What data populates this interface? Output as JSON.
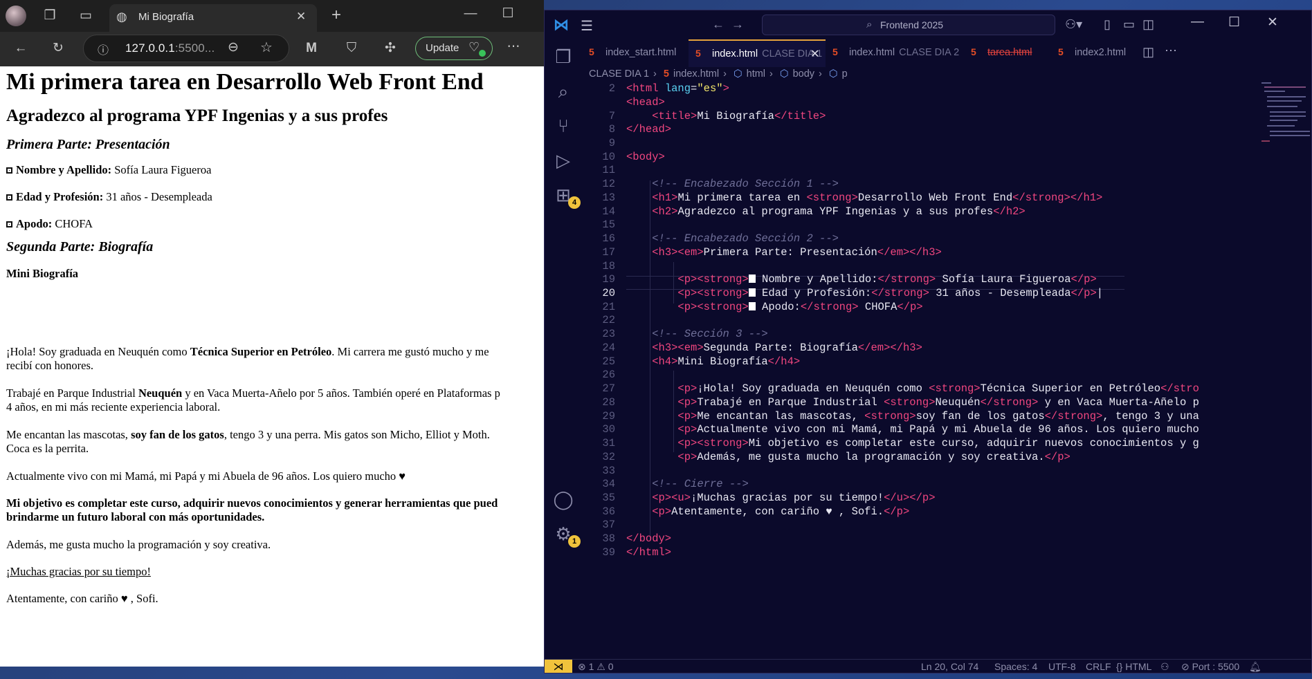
{
  "browser": {
    "tab_title": "Mi Biografía",
    "url": "127.0.0.1",
    "url_rest": ":5500...",
    "update_label": "Update"
  },
  "page": {
    "h1": "Mi primera tarea en Desarrollo Web Front End",
    "h2": "Agradezco al programa YPF Ingenias y a sus profes",
    "h3_1": "Primera Parte: Presentación",
    "item1_label": "Nombre y Apellido:",
    "item1_value": " Sofía Laura Figueroa",
    "item2_label": "Edad y Profesión:",
    "item2_value": " 31 años - Desempleada",
    "item3_label": "Apodo:",
    "item3_value": " CHOFA",
    "h3_2": "Segunda Parte: Biografía",
    "h4": "Mini Biografía",
    "p1_a": "¡Hola! Soy graduada en Neuquén como ",
    "p1_b": "Técnica Superior en Petróleo",
    "p1_c": ". Mi carrera me gustó mucho y me",
    "p1_line2": "recibí con honores.",
    "p2_a": "Trabajé en Parque Industrial ",
    "p2_b": "Neuquén",
    "p2_c": " y en Vaca Muerta-Añelo por 5 años. También operé en Plataformas p",
    "p2_line2": "4 años, en mi más reciente experiencia laboral.",
    "p3_a": "Me encantan las mascotas, ",
    "p3_b": "soy fan de los gatos",
    "p3_c": ", tengo 3 y una perra. Mis gatos son Micho, Elliot y Moth.",
    "p3_line2": "Coca es la perrita.",
    "p4": "Actualmente vivo con mi Mamá, mi Papá y mi Abuela de 96 años. Los quiero mucho ♥",
    "p5_line1": "Mi objetivo es completar este curso, adquirir nuevos conocimientos y generar herramientas que pued",
    "p5_line2": "brindarme un futuro laboral con más oportunidades.",
    "p6": "Además, me gusta mucho la programación y soy creativa.",
    "p7": "¡Muchas gracias por su tiempo!",
    "p8": "Atentamente, con cariño ♥ , Sofi."
  },
  "vscode": {
    "search": "Frontend 2025",
    "tabs": [
      {
        "name": "index_start.html",
        "desc": ""
      },
      {
        "name": "index.html",
        "desc": "CLASE DIA 1"
      },
      {
        "name": "index.html",
        "desc": "CLASE DIA 2"
      },
      {
        "name": "tarea.html",
        "desc": ""
      },
      {
        "name": "index2.html",
        "desc": ""
      }
    ],
    "breadcrumb": [
      "CLASE DIA 1",
      "index.html",
      "html",
      "body",
      "p"
    ],
    "badges": {
      "extensions": "4",
      "settings": "1"
    },
    "line_numbers": [
      "2",
      "7",
      "8",
      "9",
      "10",
      "11",
      "12",
      "13",
      "14",
      "15",
      "16",
      "17",
      "18",
      "19",
      "20",
      "21",
      "22",
      "23",
      "24",
      "25",
      "26",
      "27",
      "28",
      "29",
      "30",
      "31",
      "32",
      "33",
      "34",
      "35",
      "36",
      "37",
      "38",
      "39"
    ],
    "status": {
      "errors": "1",
      "warnings": "0",
      "position": "Ln 20, Col 74",
      "spaces": "Spaces: 4",
      "encoding": "UTF-8",
      "eol": "CRLF",
      "language": "HTML",
      "port": "Port : 5500"
    }
  }
}
